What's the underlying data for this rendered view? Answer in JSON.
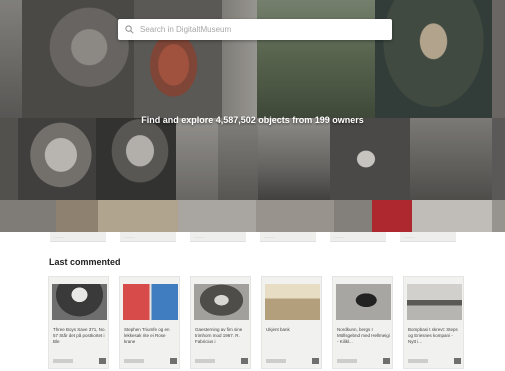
{
  "search": {
    "placeholder": "Search in DigitaltMuseum"
  },
  "hero": {
    "stats_text": "Find and explore 4,587,502 objects from 199 owners"
  },
  "strip": {
    "items": [
      "········",
      "········",
      "········",
      "········",
      "········",
      "········"
    ]
  },
  "last_commented": {
    "title": "Last commented",
    "items": [
      {
        "caption": "Three Boys Save 371, No. 57 Står det på postkortet i Ble"
      },
      {
        "caption": "Stephen Triumfe og en lekkesak rite ei Rose krane"
      },
      {
        "caption": "Gaesterning av fim sine trimhorn mod 1967. R. Fabricius i"
      },
      {
        "caption": "Ukjent bank"
      },
      {
        "caption": "Nordkunn, bergs I Möllsgebnd med Hellmeigi - Kilikl..."
      },
      {
        "caption": "Bompbasi t skrevt: Steps og Eriesnes kompani - Nytt i..."
      }
    ]
  },
  "colors": {
    "accent_red": "#c4202a",
    "card_bg": "#f1f1ef"
  }
}
